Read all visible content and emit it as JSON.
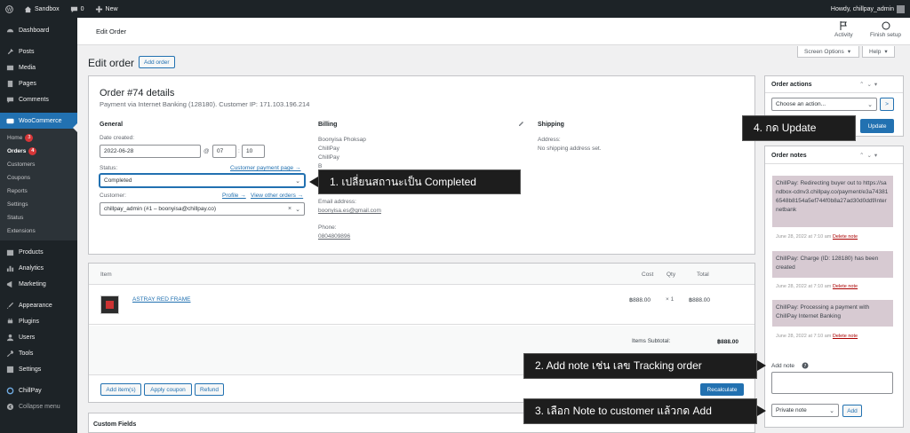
{
  "adminbar": {
    "site": "Sandbox",
    "comments": "0",
    "new": "New",
    "howdy": "Howdy, chillpay_admin"
  },
  "sidebar": {
    "dashboard": "Dashboard",
    "posts": "Posts",
    "media": "Media",
    "pages": "Pages",
    "comments": "Comments",
    "woocommerce": "WooCommerce",
    "sub": {
      "home": "Home",
      "home_badge": "3",
      "orders": "Orders",
      "orders_badge": "4",
      "customers": "Customers",
      "coupons": "Coupons",
      "reports": "Reports",
      "settings": "Settings",
      "status": "Status",
      "extensions": "Extensions"
    },
    "products": "Products",
    "analytics": "Analytics",
    "marketing": "Marketing",
    "appearance": "Appearance",
    "plugins": "Plugins",
    "users": "Users",
    "tools": "Tools",
    "settings": "Settings",
    "chillpay": "ChillPay",
    "collapse": "Collapse menu"
  },
  "header": {
    "title": "Edit Order",
    "activity": "Activity",
    "finish_setup": "Finish setup"
  },
  "screen_options": "Screen Options",
  "help": "Help",
  "page_title": "Edit order",
  "add_order": "Add order",
  "order": {
    "title": "Order #74 details",
    "subtitle": "Payment via Internet Banking (128180). Customer IP: 171.103.196.214",
    "general": "General",
    "date_created_label": "Date created:",
    "date": "2022-06-28",
    "at": "@",
    "hour": "07",
    "minute": "10",
    "status_label": "Status:",
    "customer_payment_page": "Customer payment page →",
    "status_value": "Completed",
    "customer_label": "Customer:",
    "profile": "Profile →",
    "view_other_orders": "View other orders →",
    "customer_value": "chillpay_admin (#1 – boonyisa@chillpay.co)",
    "billing": "Billing",
    "billing_lines": [
      "Boonyisa Phoksap",
      "ChillPay",
      "ChillPay",
      "B"
    ],
    "email_label": "Email address:",
    "email": "boonyisa.es@gmail.com",
    "phone_label": "Phone:",
    "phone": "0804809896",
    "shipping": "Shipping",
    "address_label": "Address:",
    "no_shipping": "No shipping address set."
  },
  "items": {
    "col_item": "Item",
    "col_cost": "Cost",
    "col_qty": "Qty",
    "col_total": "Total",
    "row": {
      "name": "ASTRAY RED FRAME",
      "cost": "฿888.00",
      "qty": "× 1",
      "total": "฿888.00"
    },
    "subtotal_label": "Items Subtotal:",
    "subtotal": "฿888.00",
    "add_items": "Add item(s)",
    "apply_coupon": "Apply coupon",
    "refund": "Refund",
    "recalculate": "Recalculate"
  },
  "custom_fields": "Custom Fields",
  "order_actions": {
    "title": "Order actions",
    "choose": "Choose an action...",
    "go": ">",
    "update": "Update"
  },
  "order_notes": {
    "title": "Order notes",
    "notes": [
      {
        "text": "ChillPay: Redirecting buyer out to https://sandbox-cdnv3.chillpay.co/payment/e3a743816548b8154a5ef744f0b8a27ad30d0ddf/internetbank",
        "date": "June 28, 2022 at 7:10 am",
        "delete": "Delete note"
      },
      {
        "text": "ChillPay: Charge (ID: 128180) has been created",
        "date": "June 28, 2022 at 7:10 am",
        "delete": "Delete note"
      },
      {
        "text": "ChillPay: Processing a payment with ChillPay Internet Banking",
        "date": "June 28, 2022 at 7:10 am",
        "delete": "Delete note"
      }
    ],
    "add_note_label": "Add note",
    "note_type": "Private note",
    "add": "Add"
  },
  "callouts": {
    "c1": "1. เปลี่ยนสถานะเป็น Completed",
    "c2": "2. Add note เช่น เลข Tracking order",
    "c3": "3. เลือก Note to customer แล้วกด Add",
    "c4": "4. กด Update"
  }
}
